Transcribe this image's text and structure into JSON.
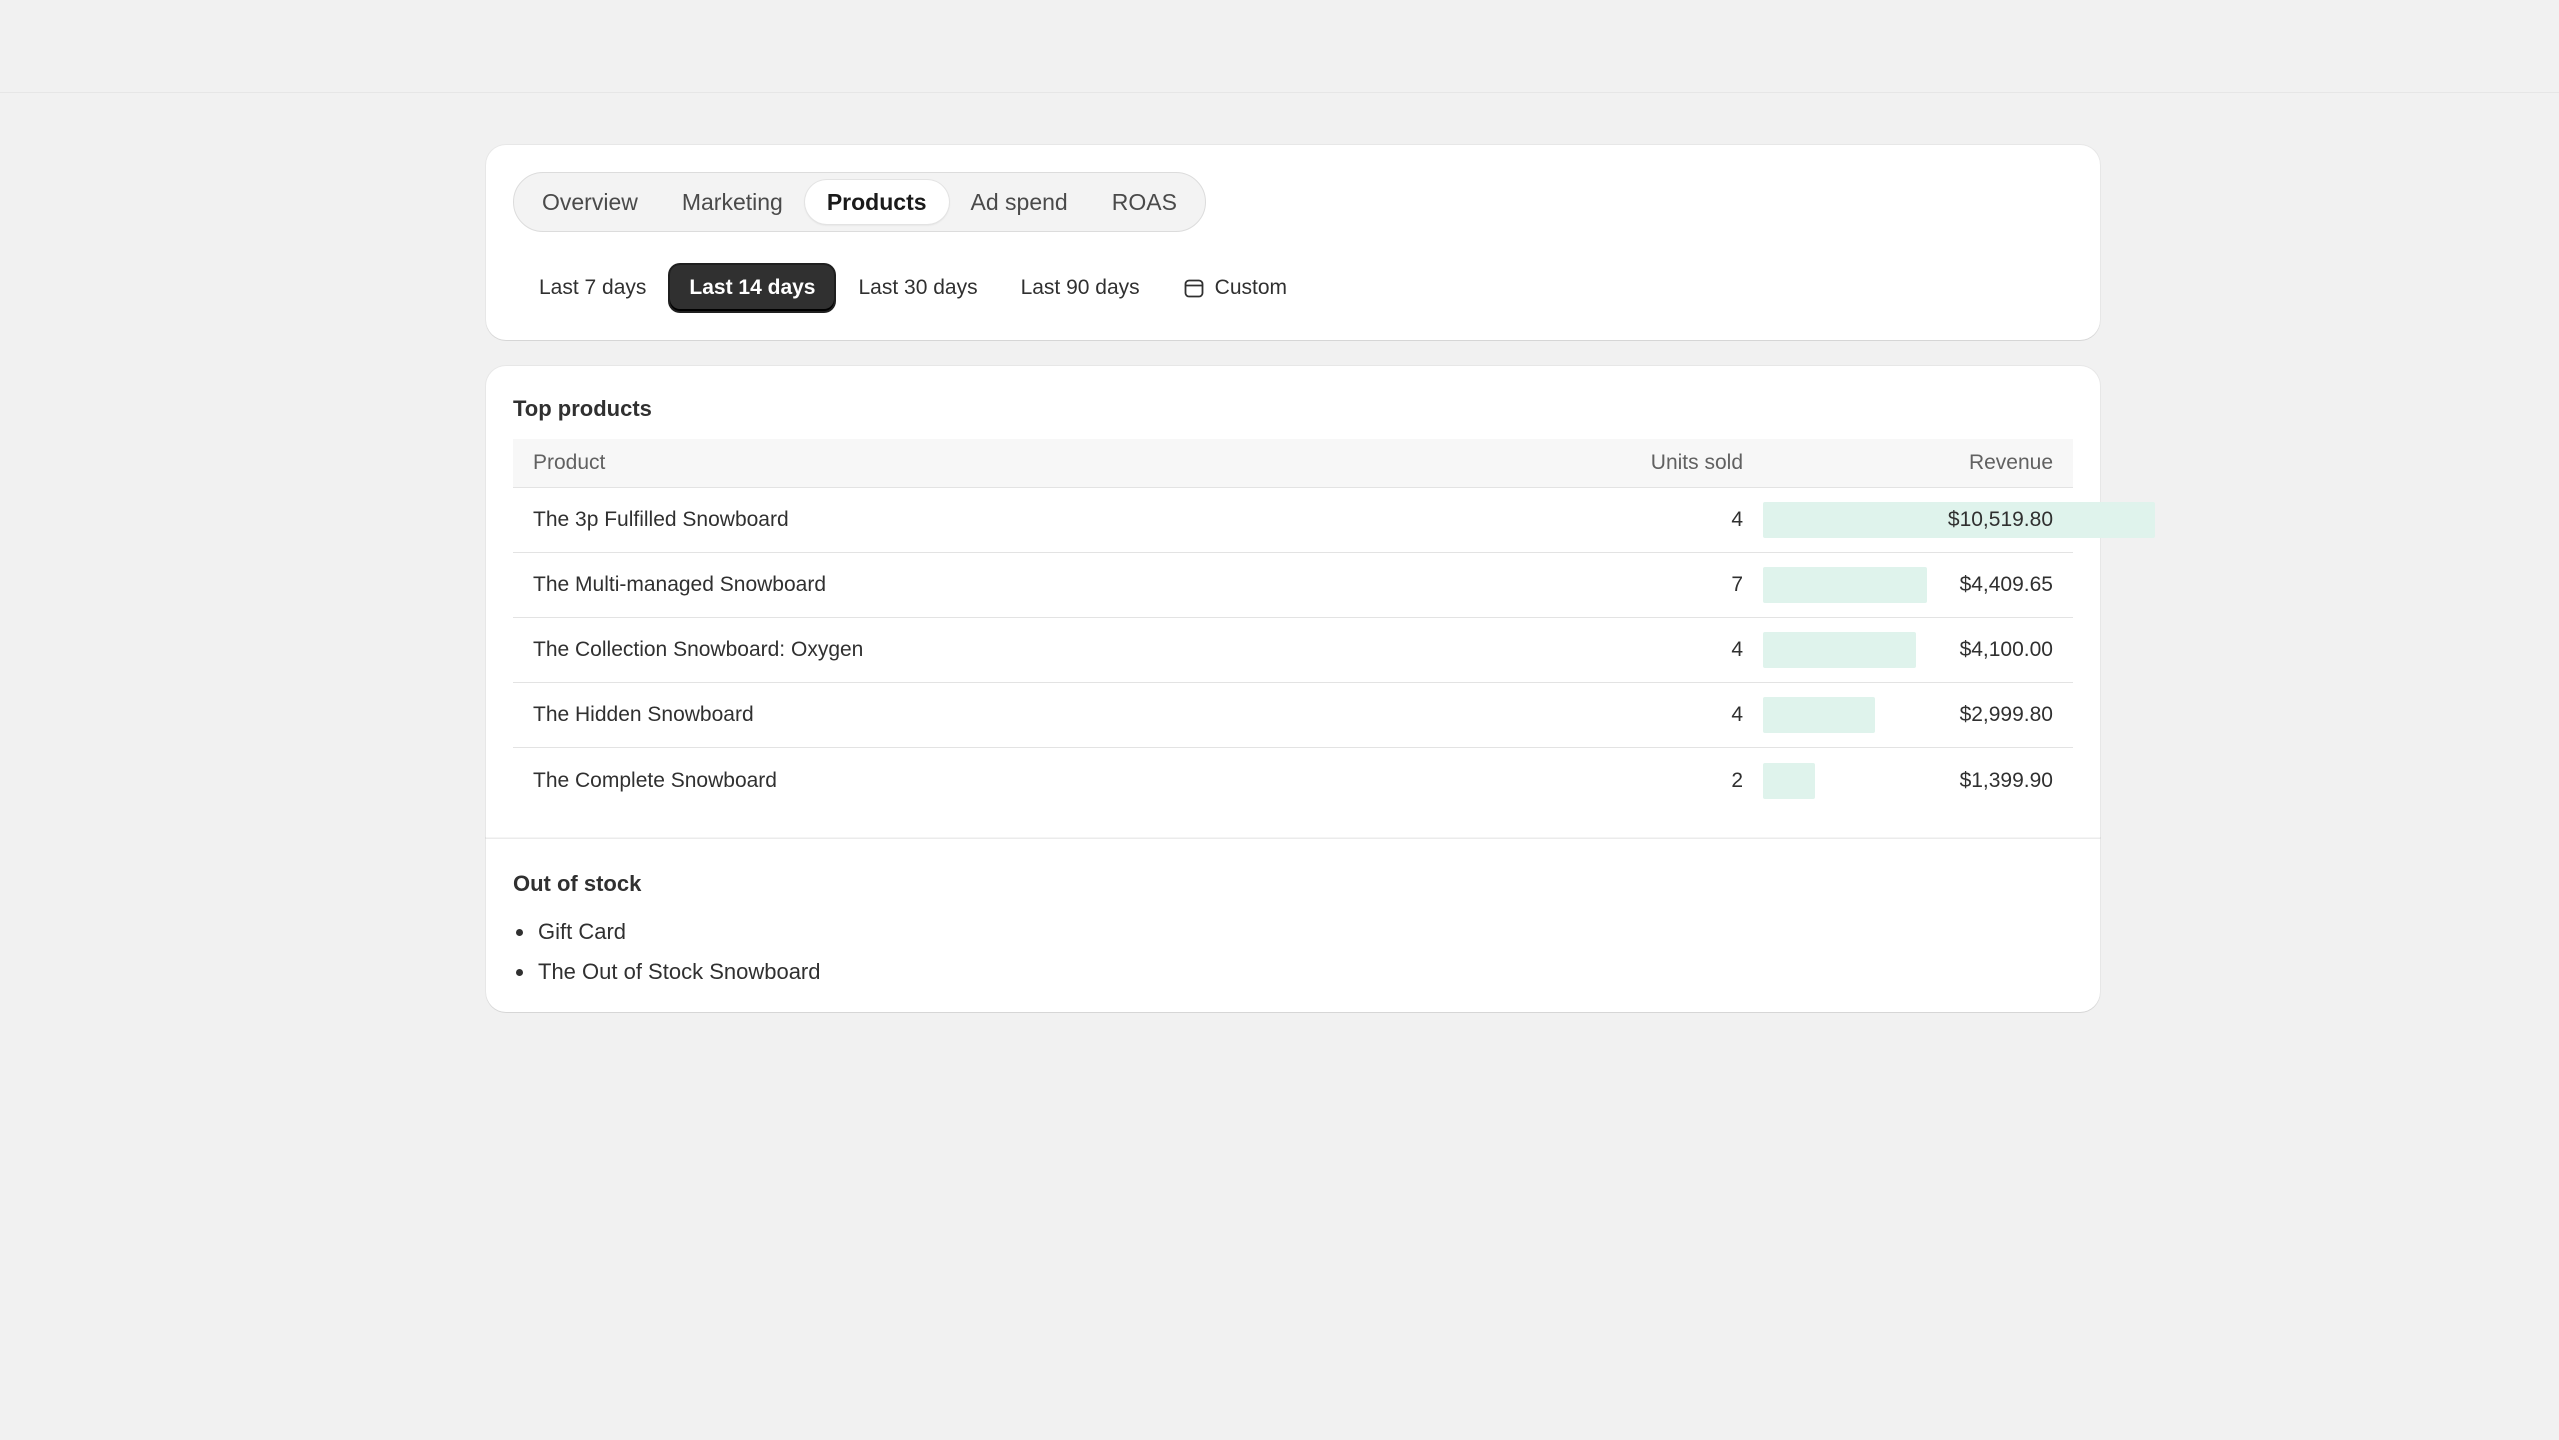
{
  "tabs": [
    {
      "label": "Overview"
    },
    {
      "label": "Marketing"
    },
    {
      "label": "Products"
    },
    {
      "label": "Ad spend"
    },
    {
      "label": "ROAS"
    }
  ],
  "active_tab": "Products",
  "ranges": [
    {
      "label": "Last 7 days"
    },
    {
      "label": "Last 14 days"
    },
    {
      "label": "Last 30 days"
    },
    {
      "label": "Last 90 days"
    },
    {
      "label": "Custom",
      "icon": "calendar-icon"
    }
  ],
  "active_range": "Last 14 days",
  "top_products": {
    "title": "Top products",
    "columns": {
      "product": "Product",
      "units": "Units sold",
      "revenue": "Revenue"
    },
    "bar_color": "#dff3ec",
    "rows": [
      {
        "product": "The 3p Fulfilled Snowboard",
        "units": "4",
        "revenue": "$10,519.80",
        "revenue_value": 10519.8
      },
      {
        "product": "The Multi-managed Snowboard",
        "units": "7",
        "revenue": "$4,409.65",
        "revenue_value": 4409.65
      },
      {
        "product": "The Collection Snowboard: Oxygen",
        "units": "4",
        "revenue": "$4,100.00",
        "revenue_value": 4100.0
      },
      {
        "product": "The Hidden Snowboard",
        "units": "4",
        "revenue": "$2,999.80",
        "revenue_value": 2999.8
      },
      {
        "product": "The Complete Snowboard",
        "units": "2",
        "revenue": "$1,399.90",
        "revenue_value": 1399.9
      }
    ]
  },
  "out_of_stock": {
    "title": "Out of stock",
    "items": [
      "Gift Card",
      "The Out of Stock Snowboard"
    ]
  }
}
